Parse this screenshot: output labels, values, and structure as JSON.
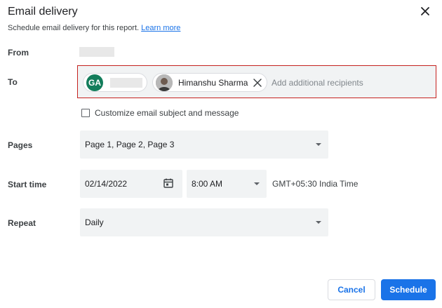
{
  "dialog": {
    "title": "Email delivery",
    "subtitle": "Schedule email delivery for this report.",
    "learn_more": "Learn more",
    "close_icon": "close-icon"
  },
  "from": {
    "label": "From"
  },
  "to": {
    "label": "To",
    "chips": [
      {
        "avatar_initials": "GA",
        "avatar_color": "#137d5b"
      },
      {
        "name": "Himanshu Sharma"
      }
    ],
    "placeholder": "Add additional recipients"
  },
  "customize": {
    "label": "Customize email subject and message",
    "checked": false
  },
  "pages": {
    "label": "Pages",
    "value": "Page 1, Page 2, Page 3"
  },
  "start_time": {
    "label": "Start time",
    "date": "02/14/2022",
    "time": "8:00 AM",
    "timezone": "GMT+05:30 India Time"
  },
  "repeat": {
    "label": "Repeat",
    "value": "Daily"
  },
  "buttons": {
    "cancel": "Cancel",
    "schedule": "Schedule"
  },
  "colors": {
    "accent": "#1a73e8",
    "error_border": "#c5221f",
    "field_bg": "#f1f3f4"
  }
}
